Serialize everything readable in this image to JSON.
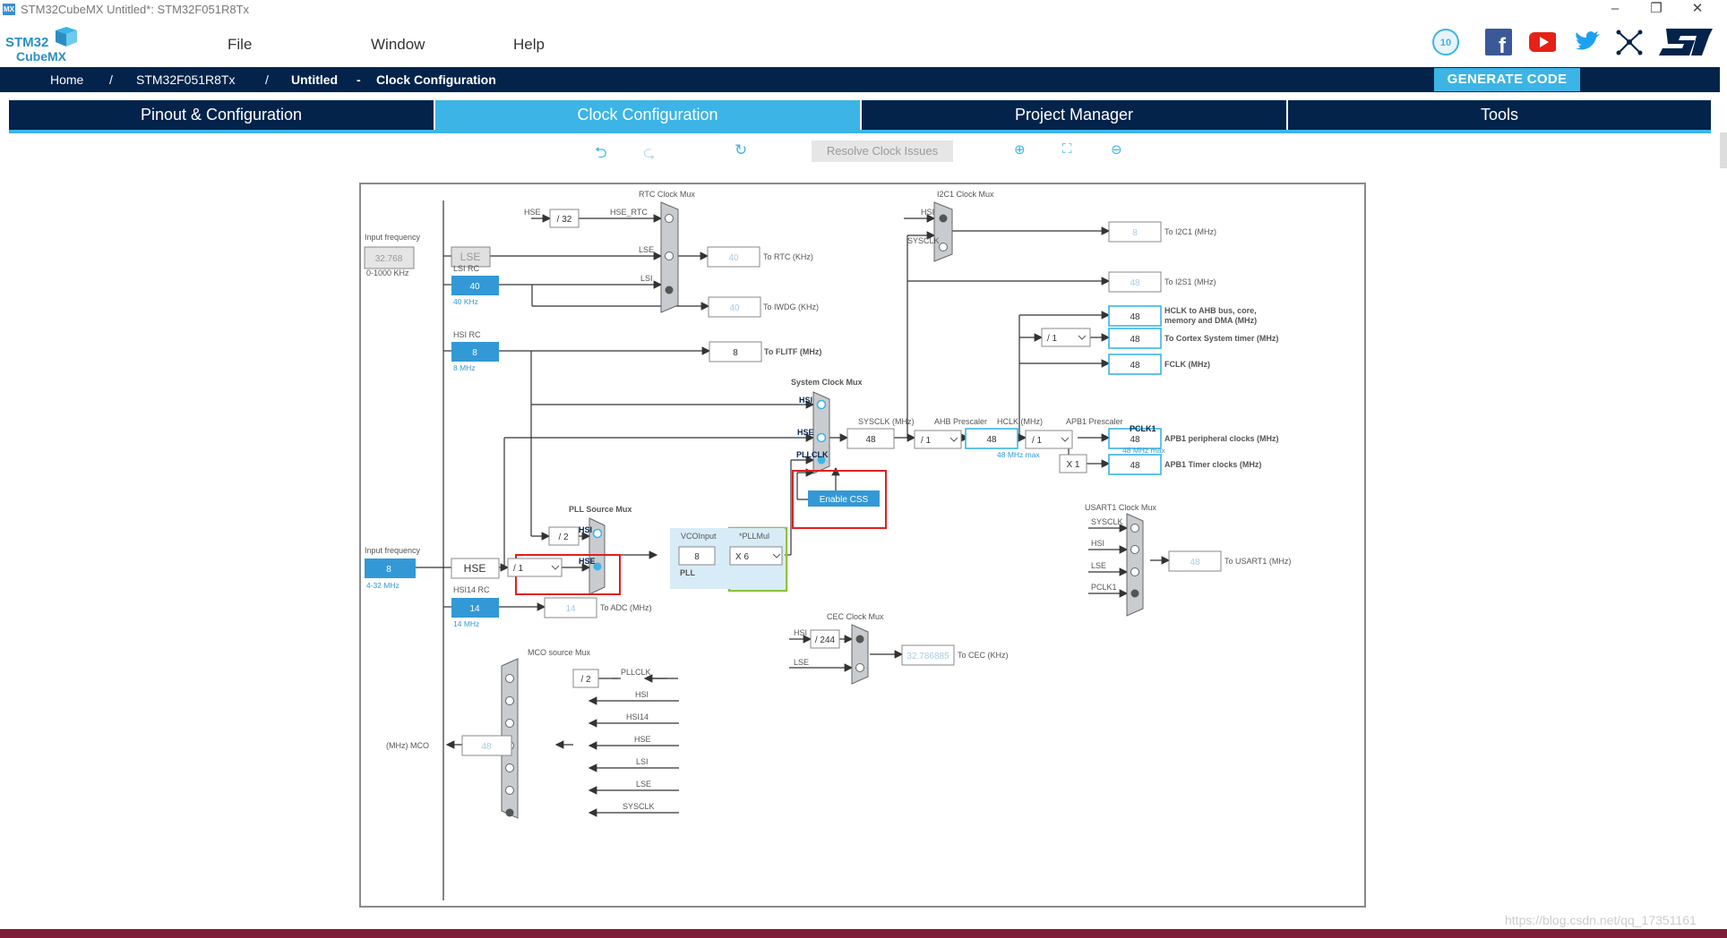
{
  "window": {
    "title": "STM32CubeMX Untitled*: STM32F051R8Tx",
    "icon_label": "MX",
    "controls": [
      "–",
      "❐",
      "✕"
    ]
  },
  "brand": {
    "line1": "STM32",
    "line2": "CubeMX"
  },
  "menu": [
    "File",
    "Window",
    "Help"
  ],
  "social_icons": [
    "anniversary-10-icon",
    "facebook-icon",
    "youtube-icon",
    "twitter-icon",
    "network-icon",
    "st-logo-icon"
  ],
  "breadcrumb": {
    "home": "Home",
    "sep1": "/",
    "mcu": "STM32F051R8Tx",
    "sep2": "/",
    "project": "Untitled",
    "sep3": "-",
    "view": "Clock Configuration"
  },
  "generate_button": "GENERATE CODE",
  "tabs": [
    "Pinout & Configuration",
    "Clock Configuration",
    "Project Manager",
    "Tools"
  ],
  "active_tab": 1,
  "toolbar": {
    "resolve": "Resolve Clock Issues"
  },
  "clock": {
    "rtc_mux_title": "RTC Clock Mux",
    "i2c1_mux_title": "I2C1 Clock Mux",
    "input_freq_label": "Input frequency",
    "lse_input_value": "32.768",
    "lse_range": "0-1000 KHz",
    "lse_label": "LSE",
    "lsi_rc_label": "LSI RC",
    "lsi_value": "40",
    "lsi_unit": "40 KHz",
    "hse_label_rtc": "HSE",
    "div32": "/ 32",
    "hse_rtc_label": "HSE_RTC",
    "lse_in_label": "LSE",
    "lsi_in_label": "LSI",
    "to_rtc_value": "40",
    "to_rtc_label": "To RTC (KHz)",
    "to_iwdg_value": "40",
    "to_iwdg_label": "To IWDG (KHz)",
    "hsi_rc_label": "HSI RC",
    "hsi_value": "8",
    "hsi_unit": "8 MHz",
    "to_flitf_value": "8",
    "to_flitf_label": "To FLITF (MHz)",
    "i2c_hsi_label": "HSI",
    "i2c_sysclk_label": "SYSCLK",
    "to_i2c1_value": "8",
    "to_i2c1_label": "To I2C1 (MHz)",
    "to_i2s1_value": "48",
    "to_i2s1_label": "To I2S1 (MHz)",
    "sysmux_title": "System Clock Mux",
    "sysmux_hsi": "HSI",
    "sysmux_hse": "HSE",
    "sysmux_pllclk": "PLLCLK",
    "enable_css": "Enable CSS",
    "sysclk_label": "SYSCLK (MHz)",
    "sysclk_value": "48",
    "ahb_label": "AHB Prescaler",
    "ahb_value": "/ 1",
    "hclk_label": "HCLK (MHz)",
    "hclk_value": "48",
    "hclk_max": "48 MHz max",
    "apb1_label": "APB1 Prescaler",
    "apb1_value": "/ 1",
    "pclk1_label": "PCLK1",
    "pclk1_max": "48 MHz max",
    "cortex_div": "/ 1",
    "x1_label": "X 1",
    "out_hclk_value": "48",
    "out_hclk_label1": "HCLK to AHB bus, core,",
    "out_hclk_label2": "memory and DMA (MHz)",
    "out_cortex_value": "48",
    "out_cortex_label": "To Cortex System timer (MHz)",
    "out_fclk_value": "48",
    "out_fclk_label": "FCLK (MHz)",
    "out_apb1p_value": "48",
    "out_apb1p_label": "APB1 peripheral clocks (MHz)",
    "out_apb1t_value": "48",
    "out_apb1t_label": "APB1 Timer clocks (MHz)",
    "pll_src_title": "PLL Source Mux",
    "pll_hsi_div": "/ 2",
    "pll_hsi_label": "HSI",
    "pll_hse_label": "HSE",
    "hse_prediv": "/ 1",
    "vcoinput_label": "VCOInput",
    "vcoinput_value": "8",
    "pll_label": "PLL",
    "pllmul_label": "*PLLMul",
    "pllmul_value": "X 6",
    "hse_input_label": "Input frequency",
    "hse_input_value": "8",
    "hse_range": "4-32 MHz",
    "hse_box_label": "HSE",
    "hsi14_label": "HSI14 RC",
    "hsi14_value": "14",
    "hsi14_unit": "14 MHz",
    "to_adc_value": "14",
    "to_adc_label": "To ADC (MHz)",
    "usart_title": "USART1 Clock Mux",
    "usart_sysclk": "SYSCLK",
    "usart_hsi": "HSI",
    "usart_lse": "LSE",
    "usart_pclk1": "PCLK1",
    "to_usart_value": "48",
    "to_usart_label": "To USART1 (MHz)",
    "cec_title": "CEC Clock Mux",
    "cec_hsi": "HSI",
    "cec_div": "/ 244",
    "cec_lse": "LSE",
    "to_cec_value": "32.786885",
    "to_cec_label": "To CEC (KHz)",
    "mco_title": "MCO source Mux",
    "mco_pllclk": "PLLCLK",
    "mco_div": "/ 2",
    "mco_hsi": "HSI",
    "mco_hsi14": "HSI14",
    "mco_hse": "HSE",
    "mco_lsi": "LSI",
    "mco_lse": "LSE",
    "mco_sysclk": "SYSCLK",
    "mco_out_label": "(MHz) MCO",
    "mco_value": "48"
  },
  "watermark": "https://blog.csdn.net/qq_17351161",
  "colors": {
    "navy": "#03234b",
    "accent": "#3cb4e6",
    "highlight_red": "#e02020",
    "highlight_green": "#8cc43c"
  }
}
